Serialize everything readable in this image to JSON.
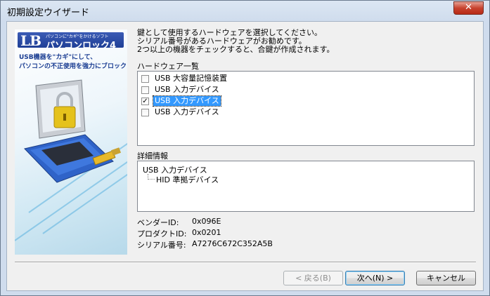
{
  "window": {
    "title": "初期設定ウイザード",
    "close_label": "✕"
  },
  "banner": {
    "logo_mark": "LB",
    "logo_small": "パソコンに\"カギ\"をかけるソフト",
    "logo_name": "パソコンロック4",
    "tagline_line1": "USB機器を\"カギ\"にして、",
    "tagline_line2": "パソコンの不正使用を強力にブロック!!"
  },
  "intro": {
    "line1": "鍵として使用するハードウェアを選択してください。",
    "line2": "シリアル番号があるハードウェアがお勧めです。",
    "line3": "2つ以上の機器をチェックすると、合鍵が作成されます。"
  },
  "hardware_list": {
    "label": "ハードウェア一覧",
    "items": [
      {
        "label": "USB 大容量記憶装置",
        "checked": false,
        "selected": false
      },
      {
        "label": "USB 入力デバイス",
        "checked": false,
        "selected": false
      },
      {
        "label": "USB 入力デバイス",
        "checked": true,
        "selected": true
      },
      {
        "label": "USB 入力デバイス",
        "checked": false,
        "selected": false
      }
    ]
  },
  "details": {
    "label": "詳細情報",
    "root": "USB 入力デバイス",
    "child": "HID 準拠デバイス"
  },
  "info": {
    "vendor_label": "ベンダーID:",
    "vendor_value": "0x096E",
    "product_label": "プロダクトID:",
    "product_value": "0x0201",
    "serial_label": "シリアル番号:",
    "serial_value": "A7276C672C352A5B"
  },
  "buttons": {
    "back": "< 戻る(B)",
    "next": "次へ(N) >",
    "cancel": "キャンセル"
  },
  "colors": {
    "selection": "#3399ff",
    "logo_blue": "#1f3f96",
    "close_red": "#c7432f"
  }
}
